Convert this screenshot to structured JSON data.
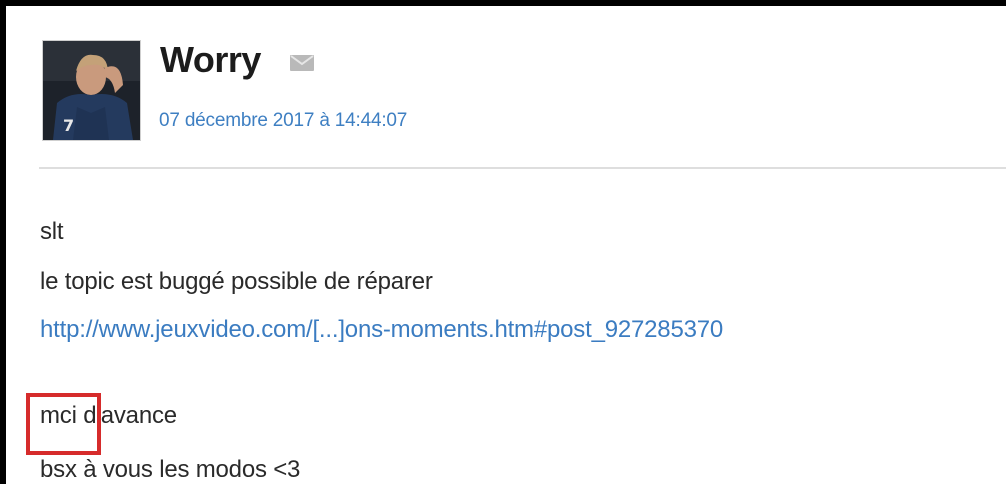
{
  "post": {
    "author": "Worry",
    "date": "07 décembre 2017 à 14:44:07",
    "avatar": {
      "icon": "user-avatar",
      "jersey_number": "7"
    },
    "mail_icon": "envelope-icon",
    "body": {
      "line1": "slt",
      "line2": "le topic est buggé possible de réparer",
      "link": "http://www.jeuxvideo.com/[...]ons-moments.htm#post_927285370",
      "line4_word": "mci",
      "line4_rest": " d'avance",
      "line5": "bsx à vous les modos <3"
    }
  },
  "colors": {
    "link": "#3b7cc1",
    "date": "#3e7fc2",
    "highlight_box": "#d62b2b",
    "text": "#2a2a2a"
  }
}
